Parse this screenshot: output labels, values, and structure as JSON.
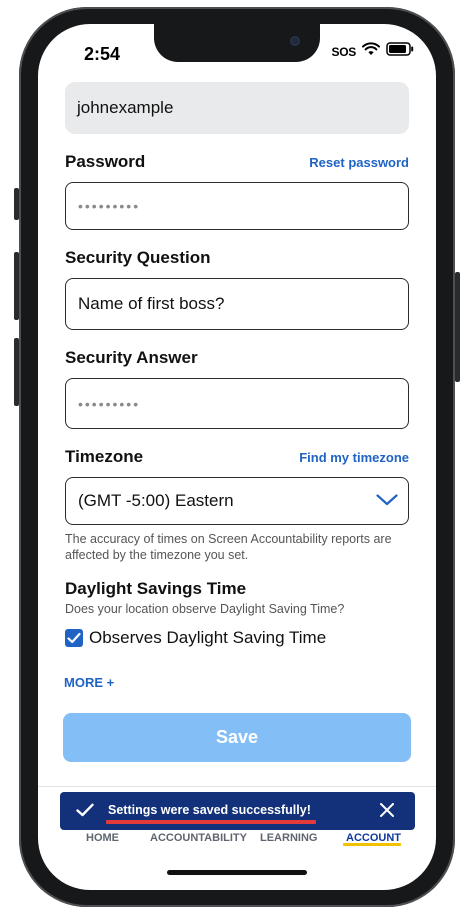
{
  "status_bar": {
    "time": "2:54",
    "sos": "SOS"
  },
  "form": {
    "username_value": "johnexample",
    "password": {
      "label": "Password",
      "link": "Reset password",
      "value": "•••••••••"
    },
    "security_question": {
      "label": "Security Question",
      "value": "Name of first boss?"
    },
    "security_answer": {
      "label": "Security Answer",
      "value": "•••••••••"
    },
    "timezone": {
      "label": "Timezone",
      "link": "Find my timezone",
      "value": "(GMT -5:00) Eastern",
      "help": "The accuracy of times on Screen Accountability reports are affected by the timezone you set."
    },
    "dst": {
      "title": "Daylight Savings Time",
      "question": "Does your location observe Daylight Saving Time?",
      "checkbox_label": "Observes Daylight Saving Time",
      "checked": true
    },
    "more_label": "MORE +",
    "save_label": "Save"
  },
  "toast": {
    "message": "Settings were saved successfully!"
  },
  "tabs": [
    {
      "label": "HOME"
    },
    {
      "label": "ACCOUNTABILITY"
    },
    {
      "label": "LEARNING"
    },
    {
      "label": "ACCOUNT",
      "active": true
    }
  ],
  "colors": {
    "accent": "#1f63c4",
    "toast_bg": "#12317a",
    "save_disabled": "#84bef7",
    "active_tab_underline": "#f2c200",
    "annotation_red": "#e53a3a"
  }
}
